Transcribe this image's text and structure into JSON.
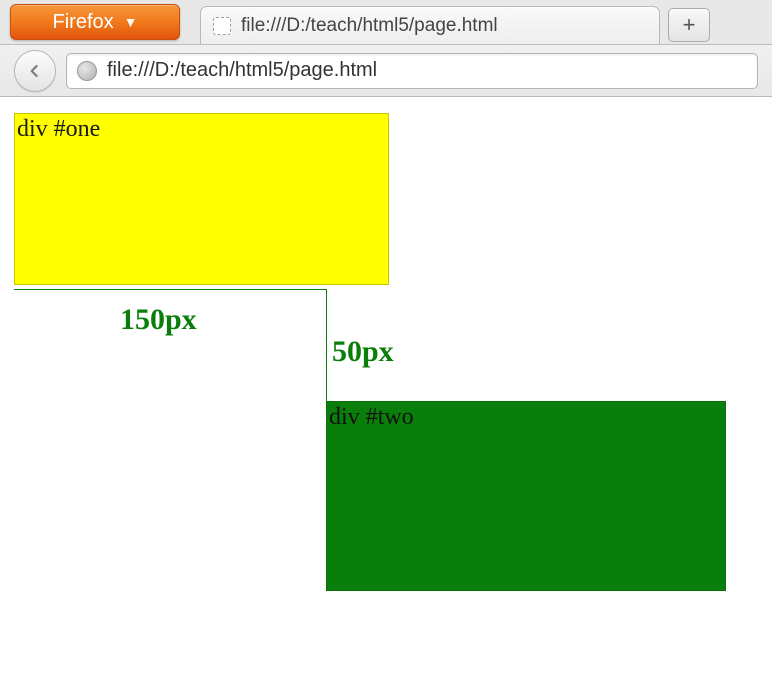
{
  "browser": {
    "name": "Firefox",
    "tab_title": "file:///D:/teach/html5/page.html",
    "url": "file:///D:/teach/html5/page.html",
    "new_tab_symbol": "+"
  },
  "page": {
    "div_one_text": "div #one",
    "div_two_text": "div #two",
    "measure_horizontal": "150px",
    "measure_vertical": "50px"
  }
}
